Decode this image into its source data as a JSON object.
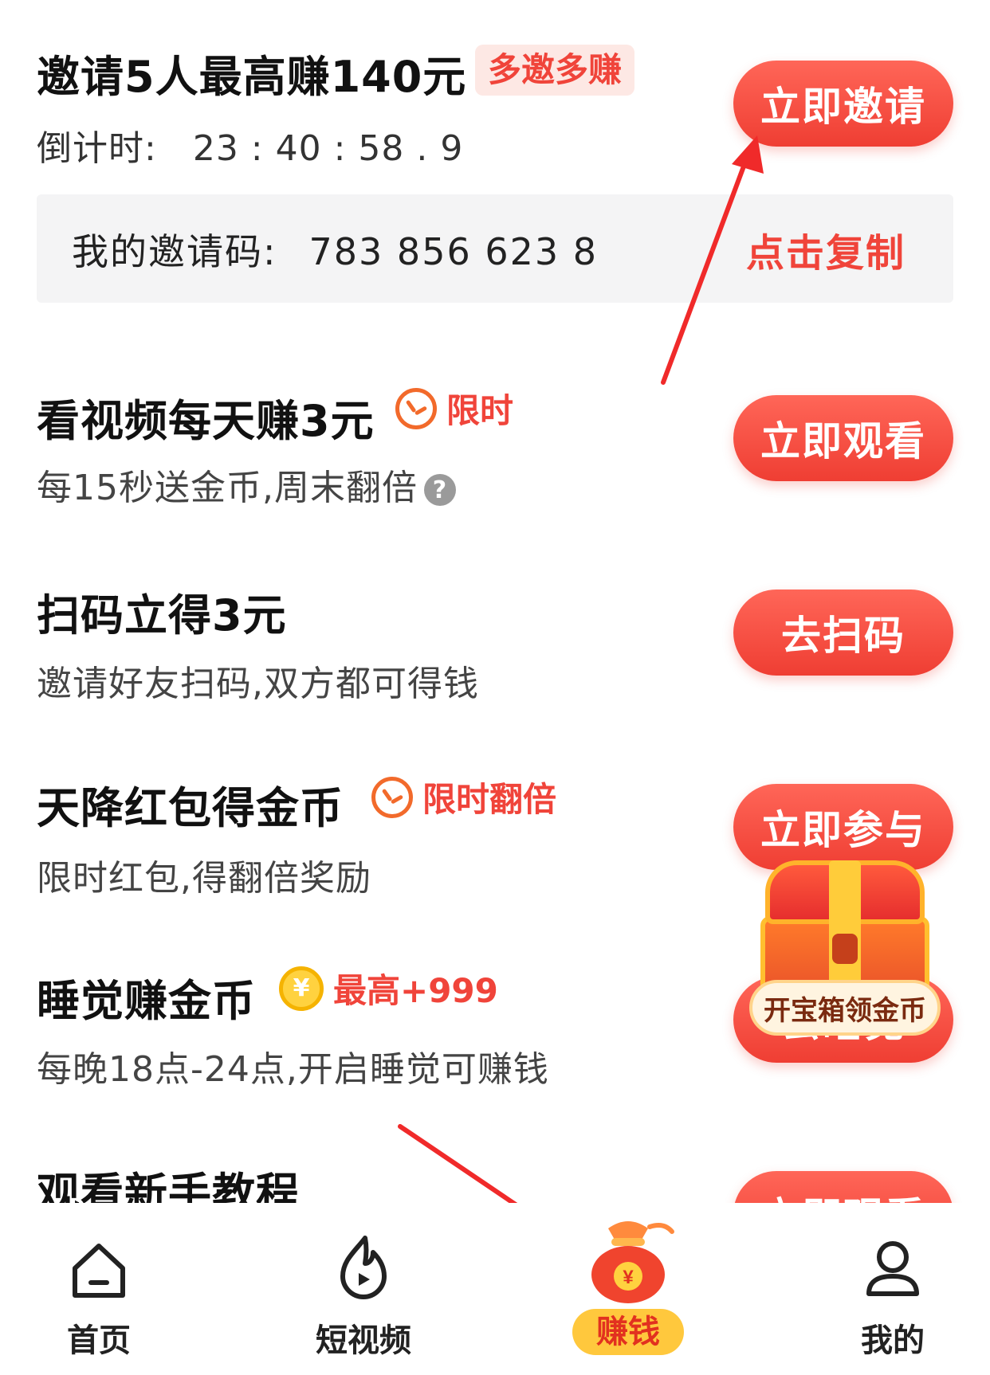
{
  "invite": {
    "title": "邀请5人最高赚140元",
    "badge": "多邀多赚",
    "countdown_label": "倒计时:",
    "countdown_value": "23 : 40 : 58 . 9",
    "button": "立即邀请",
    "code_label": "我的邀请码:",
    "code_value": "783 856 623 8",
    "copy": "点击复制"
  },
  "tasks": [
    {
      "title": "看视频每天赚3元",
      "tag": "限时",
      "tag_icon": "clock-icon",
      "subtitle": "每15秒送金币,周末翻倍",
      "help_icon": "?",
      "button": "立即观看"
    },
    {
      "title": "扫码立得3元",
      "subtitle": "邀请好友扫码,双方都可得钱",
      "button": "去扫码"
    },
    {
      "title": "天降红包得金币",
      "tag": "限时翻倍",
      "tag_icon": "clock-icon",
      "subtitle": "限时红包,得翻倍奖励",
      "button": "立即参与"
    },
    {
      "title": "睡觉赚金币",
      "tag": "最高+999",
      "tag_icon": "coin-icon",
      "coin_symbol": "¥",
      "subtitle": "每晚18点-24点,开启睡觉可赚钱",
      "button": "去睡觉"
    },
    {
      "title": "观看新手教程",
      "button": "立即观看"
    }
  ],
  "treasure_chest": {
    "label": "开宝箱领金币"
  },
  "tabbar": {
    "items": [
      {
        "label": "首页",
        "icon": "home-icon"
      },
      {
        "label": "短视频",
        "icon": "flame-play-icon"
      },
      {
        "label": "赚钱",
        "icon": "money-bag-icon",
        "active": true,
        "symbol": "¥"
      },
      {
        "label": "我的",
        "icon": "user-icon"
      }
    ]
  },
  "colors": {
    "accent": "#ef3e33",
    "badge_bg": "#fde8e4",
    "tab_active_bg": "#ffc83d",
    "clock": "#f26a2b",
    "coin": "#ffd23f"
  }
}
